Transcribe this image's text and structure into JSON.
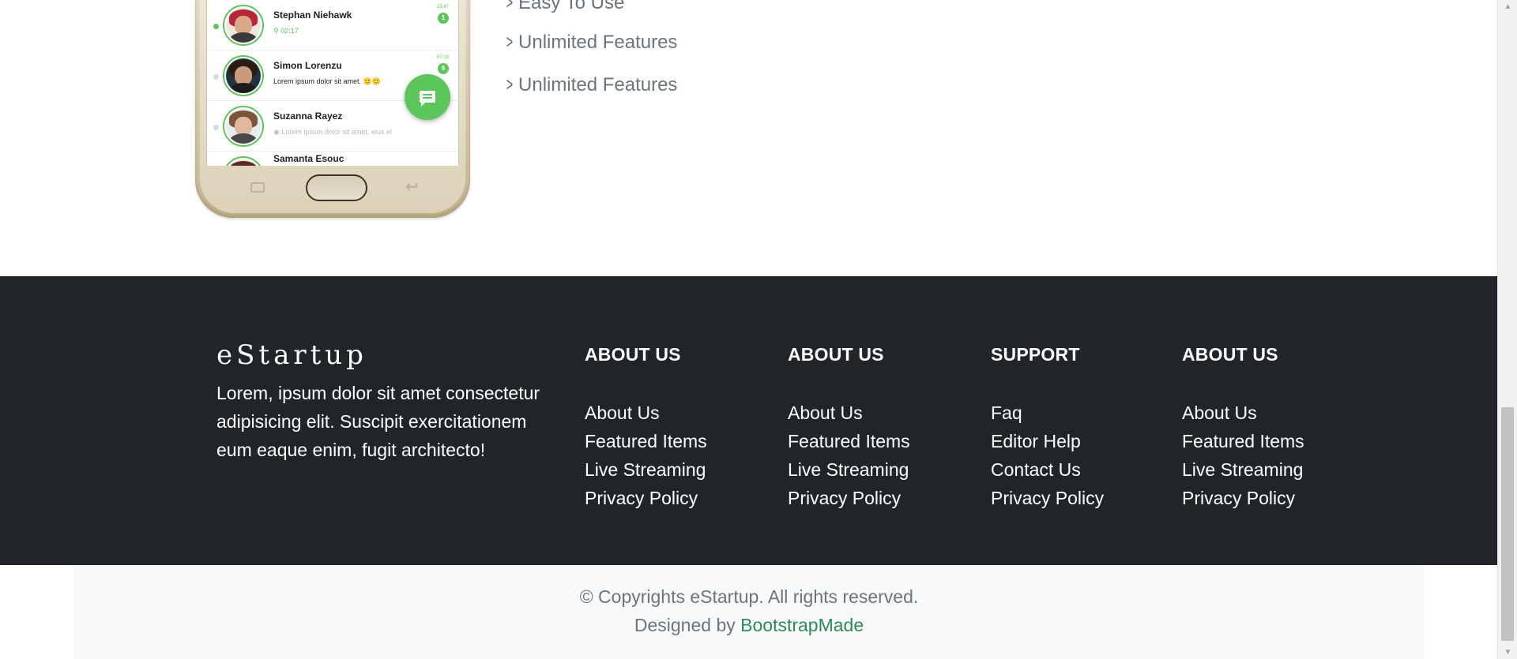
{
  "features": {
    "items": [
      {
        "label": "Easy To Use"
      },
      {
        "label": "Unlimited Features"
      },
      {
        "label": "Unlimited Features"
      }
    ]
  },
  "phone": {
    "chats": [
      {
        "name": "Stephan Niehawk",
        "message": "02:17",
        "time": "23:47",
        "badge": "1"
      },
      {
        "name": "Simon Lorenzu",
        "message": "Lorem ipsum dolor sit amet.",
        "time": "07:18",
        "badge": "6"
      },
      {
        "name": "Suzanna Rayez",
        "message": "Lorem ipsum dolor sit amet, eius el"
      },
      {
        "name": "Samanta Esouc",
        "message": ""
      }
    ]
  },
  "footer": {
    "brand": "eStartup",
    "description": "Lorem, ipsum dolor sit amet consectetur adipisicing elit. Suscipit exercitationem eum eaque enim, fugit architecto!",
    "columns": [
      {
        "heading": "ABOUT US",
        "links": [
          "About Us",
          "Featured Items",
          "Live Streaming",
          "Privacy Policy"
        ]
      },
      {
        "heading": "ABOUT US",
        "links": [
          "About Us",
          "Featured Items",
          "Live Streaming",
          "Privacy Policy"
        ]
      },
      {
        "heading": "SUPPORT",
        "links": [
          "Faq",
          "Editor Help",
          "Contact Us",
          "Privacy Policy"
        ]
      },
      {
        "heading": "ABOUT US",
        "links": [
          "About Us",
          "Featured Items",
          "Live Streaming",
          "Privacy Policy"
        ]
      }
    ],
    "copyright": "© Copyrights eStartup. All rights reserved.",
    "credits_prefix": "Designed by",
    "credits_link": "BootstrapMade"
  },
  "colors": {
    "footer_bg": "#212529",
    "accent_green": "#5cc65c",
    "link_green": "#2e8b57",
    "muted_text": "#6c757d"
  },
  "scrollbar": {
    "position_fraction": 0.9
  }
}
